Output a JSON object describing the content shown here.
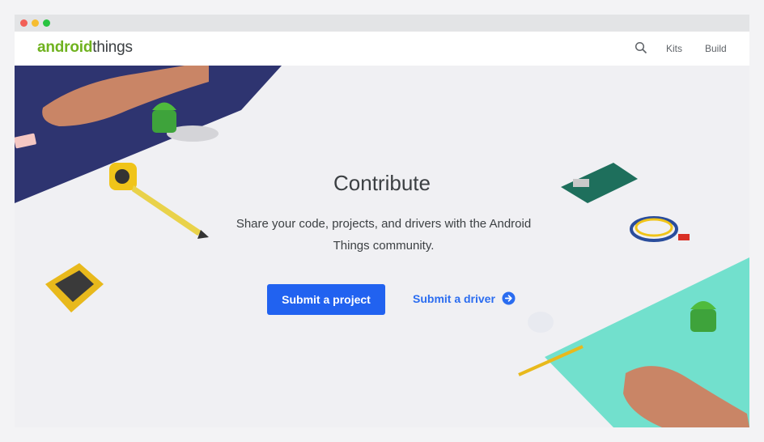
{
  "window": {
    "controls": [
      "close",
      "minimize",
      "maximize"
    ]
  },
  "nav": {
    "logo_bold": "android",
    "logo_light": "things",
    "links": [
      "Kits",
      "Build"
    ],
    "search_icon": "search-icon"
  },
  "hero": {
    "title": "Contribute",
    "description": "Share your code, projects, and drivers with the Android Things community.",
    "primary_button": "Submit a project",
    "secondary_link": "Submit a driver",
    "secondary_link_icon": "arrow-right-circle-icon"
  },
  "colors": {
    "brand_green": "#6fb21e",
    "primary_blue": "#2162f0",
    "navy_panel": "#2e3470",
    "mint_panel": "#6fe0cd"
  }
}
